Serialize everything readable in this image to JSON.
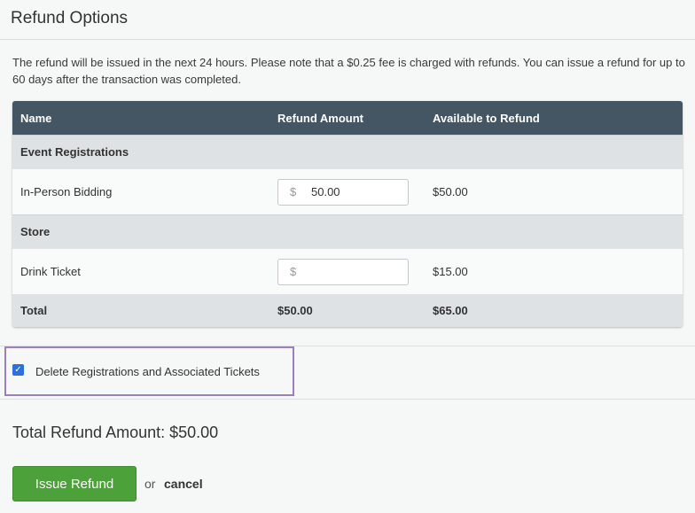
{
  "page": {
    "title": "Refund Options",
    "intro": "The refund will be issued in the next 24 hours. Please note that a $0.25 fee is charged with refunds. You can issue a refund for up to 60 days after the transaction was completed."
  },
  "table": {
    "headers": {
      "name": "Name",
      "refund_amount": "Refund Amount",
      "available": "Available to Refund"
    },
    "sections": [
      {
        "label": "Event Registrations",
        "items": [
          {
            "name": "In-Person Bidding",
            "currency_symbol": "$",
            "refund_value": "50.00",
            "available": "$50.00"
          }
        ]
      },
      {
        "label": "Store",
        "items": [
          {
            "name": "Drink Ticket",
            "currency_symbol": "$",
            "refund_value": "",
            "available": "$15.00"
          }
        ]
      }
    ],
    "total": {
      "label": "Total",
      "refund": "$50.00",
      "available": "$65.00"
    }
  },
  "options": {
    "delete_registrations_checked": true,
    "delete_registrations_label": "Delete Registrations and Associated Tickets"
  },
  "summary": {
    "total_refund_text": "Total Refund Amount: $50.00"
  },
  "actions": {
    "issue_refund_label": "Issue Refund",
    "or_text": "or",
    "cancel_label": "cancel"
  },
  "colors": {
    "table_header": "#445664",
    "section_row": "#dfe2e4",
    "primary_button": "#4da13a",
    "highlight_border": "#9b7fc2",
    "checkbox": "#2c6fde"
  }
}
